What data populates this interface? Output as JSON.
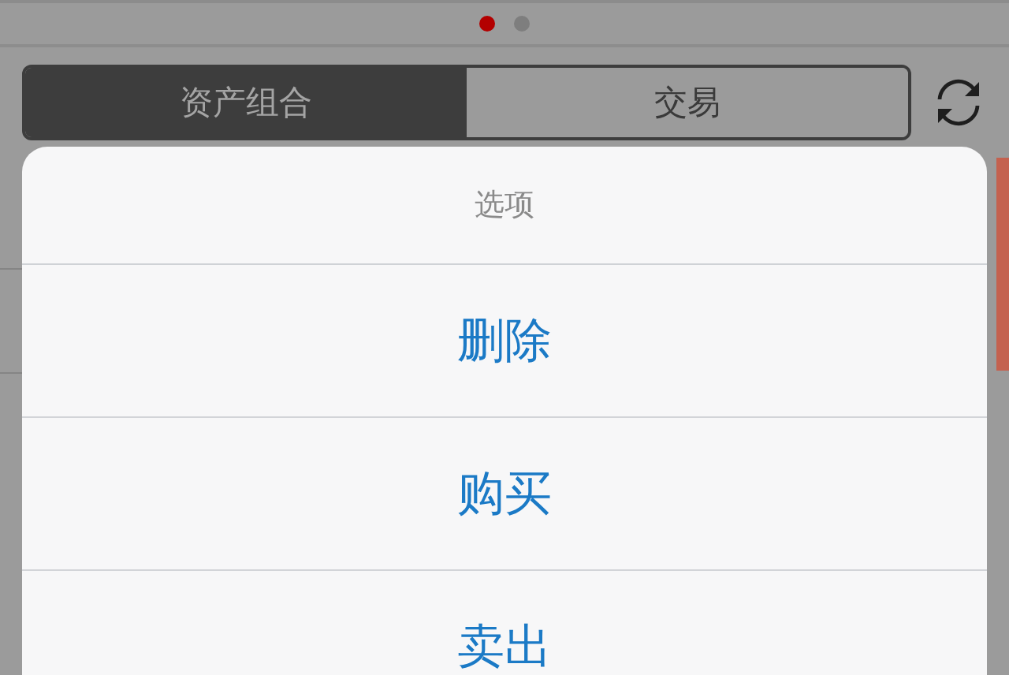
{
  "pager": {
    "dots": [
      {
        "selected": true
      },
      {
        "selected": false
      }
    ]
  },
  "segments": [
    {
      "label": "资产组合",
      "selected": true
    },
    {
      "label": "交易",
      "selected": false
    }
  ],
  "sheet": {
    "title": "选项",
    "actions": [
      {
        "label": "删除"
      },
      {
        "label": "购买"
      },
      {
        "label": "卖出"
      }
    ]
  }
}
